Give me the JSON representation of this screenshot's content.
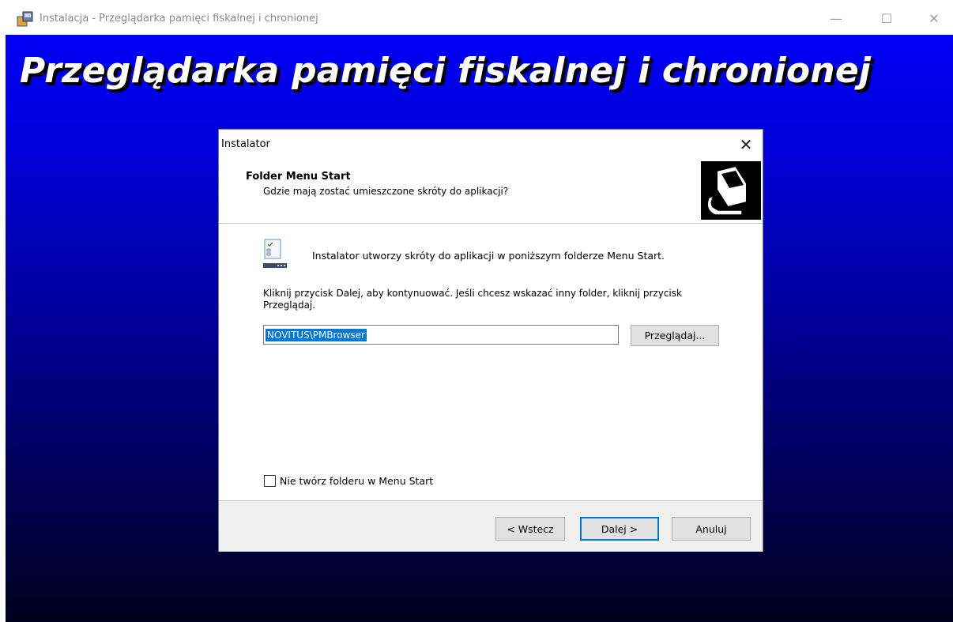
{
  "window": {
    "title": "Instalacja - Przeglądarka pamięci fiskalnej i chronionej",
    "minimize": "—",
    "maximize": "☐",
    "close": "✕"
  },
  "backdrop": {
    "headline": "Przeglądarka pamięci fiskalnej i chronionej"
  },
  "dialog": {
    "title": "Instalator",
    "close": "✕",
    "header": {
      "title": "Folder Menu Start",
      "subtitle": "Gdzie mają zostać umieszczone skróty do aplikacji?"
    },
    "body": {
      "intro": "Instalator utworzy skróty do aplikacji w poniższym folderze Menu Start.",
      "hint": "Kliknij przycisk Dalej, aby kontynuować. Jeśli chcesz wskazać inny folder, kliknij przycisk Przeglądaj.",
      "folder_value": "NOVITUS\\PMBrowser",
      "browse_label": "Przeglądaj...",
      "checkbox_label": "Nie twórz folderu w Menu Start",
      "checkbox_checked": false
    },
    "footer": {
      "back_label": "< Wstecz",
      "next_label": "Dalej >",
      "cancel_label": "Anuluj"
    }
  },
  "colors": {
    "accent": "#0078d7",
    "backdrop_top": "#0000f5",
    "backdrop_bottom": "#00001e"
  },
  "icons": [
    "installer-app-icon",
    "computer-wizard-icon",
    "start-menu-folder-icon",
    "minimize-icon",
    "maximize-icon",
    "close-icon"
  ]
}
